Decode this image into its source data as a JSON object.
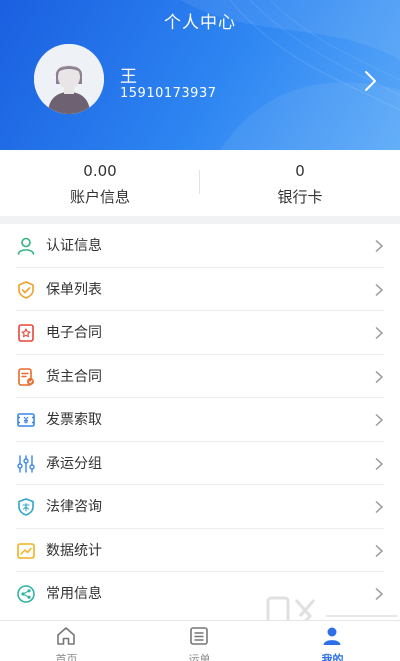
{
  "header": {
    "title": "个人中心",
    "user_name": "王",
    "phone": "15910173937"
  },
  "stats": [
    {
      "value": "0.00",
      "label": "账户信息"
    },
    {
      "value": "0",
      "label": "银行卡"
    }
  ],
  "menu": [
    {
      "label": "认证信息",
      "icon": "user-icon",
      "color": "#35b37e"
    },
    {
      "label": "保单列表",
      "icon": "shield-check-icon",
      "color": "#f0a02b"
    },
    {
      "label": "电子合同",
      "icon": "contract-star-icon",
      "color": "#e8473a"
    },
    {
      "label": "货主合同",
      "icon": "document-icon",
      "color": "#e86b2b"
    },
    {
      "label": "发票索取",
      "icon": "invoice-icon",
      "color": "#3a86e8"
    },
    {
      "label": "承运分组",
      "icon": "sliders-icon",
      "color": "#3a86e8"
    },
    {
      "label": "法律咨询",
      "icon": "law-shield-icon",
      "color": "#2fa7c9"
    },
    {
      "label": "数据统计",
      "icon": "chart-card-icon",
      "color": "#f0b01e"
    },
    {
      "label": "常用信息",
      "icon": "share-icon",
      "color": "#2fb3a4"
    }
  ],
  "tabs": [
    {
      "label": "首页",
      "icon": "home-icon",
      "active": false
    },
    {
      "label": "运单",
      "icon": "list-icon",
      "active": false
    },
    {
      "label": "我的",
      "icon": "person-icon",
      "active": true
    }
  ],
  "colors": {
    "accent": "#2d6fe8",
    "header_start": "#1a5fe0",
    "header_end": "#5aa9f8",
    "background": "#f1f2f4"
  }
}
